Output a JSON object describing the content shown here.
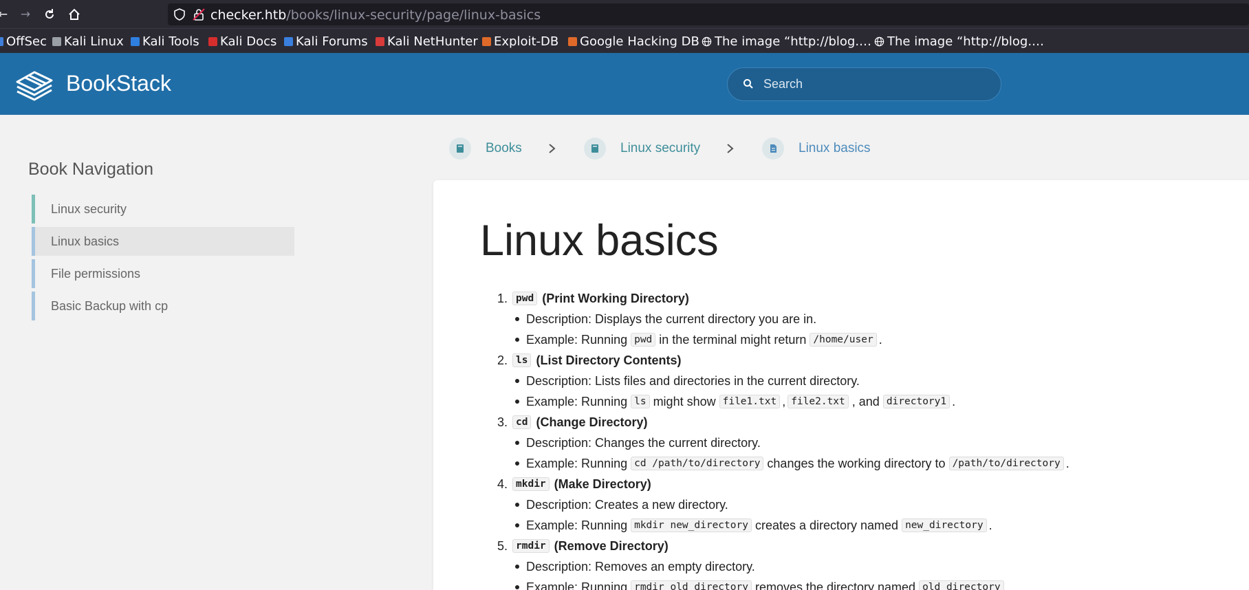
{
  "browser": {
    "url_host": "checker.htb",
    "url_path": "/books/linux-security/page/linux-basics",
    "bookmarks": [
      {
        "label": "OffSec",
        "color": "#3f7fd9"
      },
      {
        "label": "Kali Linux",
        "color": "#9aa0a6"
      },
      {
        "label": "Kali Tools",
        "color": "#2f7fe0"
      },
      {
        "label": "Kali Docs",
        "color": "#d62d2d"
      },
      {
        "label": "Kali Forums",
        "color": "#3a7fde"
      },
      {
        "label": "Kali NetHunter",
        "color": "#d93b3b"
      },
      {
        "label": "Exploit-DB",
        "color": "#e06a2a"
      },
      {
        "label": "Google Hacking DB",
        "color": "#e06a2a"
      },
      {
        "label": "The image “http://blog.…",
        "color": "globe"
      },
      {
        "label": "The image “http://blog.…",
        "color": "globe"
      }
    ]
  },
  "app": {
    "name": "BookStack",
    "search_placeholder": "Search"
  },
  "breadcrumb": {
    "items": [
      "Books",
      "Linux security",
      "Linux basics"
    ]
  },
  "sidebar": {
    "title": "Book Navigation",
    "items": [
      "Linux security",
      "Linux basics",
      "File permissions",
      "Basic Backup with cp"
    ]
  },
  "page": {
    "title": "Linux basics",
    "commands": [
      {
        "num": "1.",
        "cmd": "pwd",
        "title": "(Print Working Directory)",
        "desc": "Description: Displays the current directory you are in.",
        "ex_pre": "Example: Running",
        "ex_code1": "pwd",
        "ex_mid": "in the terminal might return",
        "ex_code2": "/home/user",
        "ex_end": "."
      },
      {
        "num": "2.",
        "cmd": "ls",
        "title": "(List Directory Contents)",
        "desc": "Description: Lists files and directories in the current directory.",
        "ex_pre": "Example: Running",
        "ex_code1": "ls",
        "ex_mid": "might show",
        "ex_code2": "file1.txt",
        "ex_sep1": ",",
        "ex_code3": "file2.txt",
        "ex_sep2": ", and",
        "ex_code4": "directory1",
        "ex_end": "."
      },
      {
        "num": "3.",
        "cmd": "cd",
        "title": "(Change Directory)",
        "desc": "Description: Changes the current directory.",
        "ex_pre": "Example: Running",
        "ex_code1": "cd /path/to/directory",
        "ex_mid": "changes the working directory to",
        "ex_code2": "/path/to/directory",
        "ex_end": "."
      },
      {
        "num": "4.",
        "cmd": "mkdir",
        "title": "(Make Directory)",
        "desc": "Description: Creates a new directory.",
        "ex_pre": "Example: Running",
        "ex_code1": "mkdir new_directory",
        "ex_mid": "creates a directory named",
        "ex_code2": "new_directory",
        "ex_end": "."
      },
      {
        "num": "5.",
        "cmd": "rmdir",
        "title": "(Remove Directory)",
        "desc": "Description: Removes an empty directory.",
        "ex_pre": "Example: Running",
        "ex_code1": "rmdir old_directory",
        "ex_mid": "removes the directory named",
        "ex_code2": "old_directory",
        "ex_end": "."
      }
    ]
  },
  "colors": {
    "header": "#206ea7",
    "chapter_accent": "#7ebfb8",
    "page_accent": "#a4c4df",
    "link": "#3e8e9a"
  }
}
